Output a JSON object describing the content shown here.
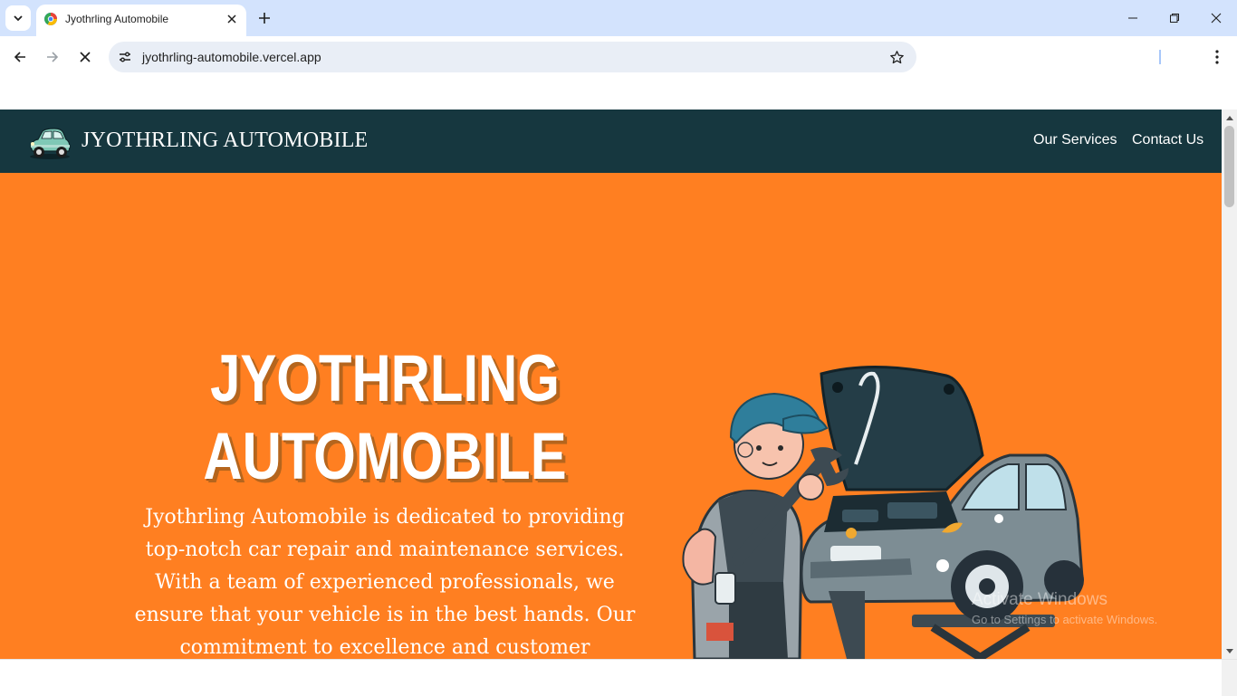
{
  "browser": {
    "tab": {
      "title": "Jyothrling Automobile",
      "favicon": "chrome-loading-favicon"
    },
    "url": "jyothrling-automobile.vercel.app",
    "icons": {
      "tab_list": "chevron-down-icon",
      "close_tab": "close-icon",
      "new_tab": "plus-icon",
      "back": "back-arrow-icon",
      "forward": "forward-arrow-icon",
      "stop": "stop-loading-icon",
      "site_info": "site-info-icon",
      "bookmark": "star-icon",
      "menu": "kebab-menu-icon",
      "minimize": "minimize-icon",
      "restore": "restore-icon",
      "close_window": "close-window-icon"
    }
  },
  "site": {
    "brand": "JYOTHRLING AUTOMOBILE",
    "logo": "vintage-car-logo",
    "nav": [
      {
        "label": "Our Services"
      },
      {
        "label": "Contact Us"
      }
    ],
    "hero": {
      "title_line1": "JYOTHRLING",
      "title_line2": "AUTOMOBILE",
      "description_lines": [
        "Jyothrling Automobile is dedicated to providing",
        "top-notch car repair and maintenance services.",
        "With a team of experienced professionals, we",
        "ensure that your vehicle is in the best hands. Our",
        "commitment to excellence and customer"
      ],
      "illustration": "mechanic-with-wrench-and-car-illustration"
    }
  },
  "os_watermark": {
    "line1": "Activate Windows",
    "line2": "Go to Settings to activate Windows."
  },
  "colors": {
    "tabbar": "#d3e3fd",
    "header": "#16373f",
    "hero_bg": "#ff7f21",
    "title_shadow": "#b5651d"
  }
}
